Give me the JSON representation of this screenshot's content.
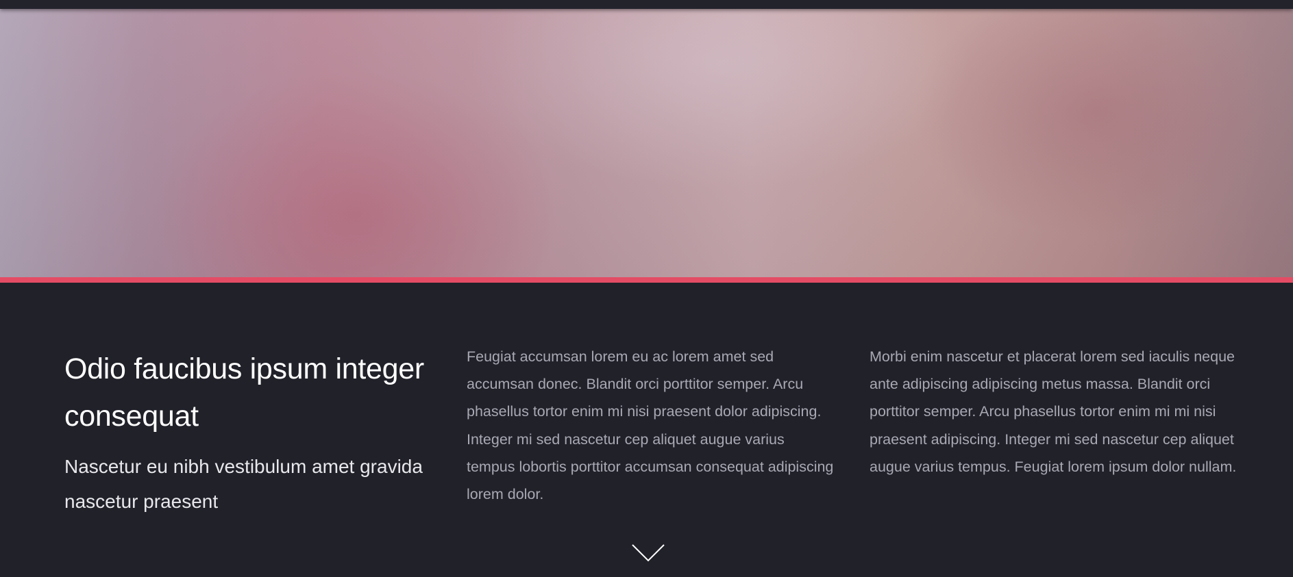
{
  "hero": {
    "accent_color": "#e44c65"
  },
  "intro": {
    "heading": "Odio faucibus ipsum integer consequat",
    "subheading": "Nascetur eu nibh vestibulum amet gravida nascetur praesent"
  },
  "columns": [
    {
      "text": "Feugiat accumsan lorem eu ac lorem amet sed accumsan donec. Blandit orci porttitor semper. Arcu phasellus tortor enim mi nisi praesent dolor adipiscing. Integer mi sed nascetur cep aliquet augue varius tempus lobortis porttitor accumsan consequat adipiscing lorem dolor."
    },
    {
      "text": "Morbi enim nascetur et placerat lorem sed iaculis neque ante adipiscing adipiscing metus massa. Blandit orci porttitor semper. Arcu phasellus tortor enim mi mi nisi praesent adipiscing. Integer mi sed nascetur cep aliquet augue varius tempus. Feugiat lorem ipsum dolor nullam."
    }
  ],
  "scroll": {
    "icon": "chevron-down-icon"
  }
}
